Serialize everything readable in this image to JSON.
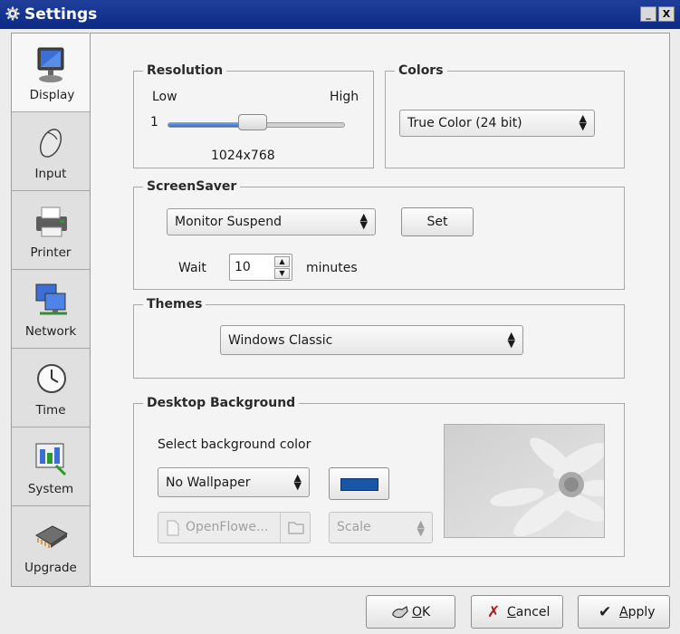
{
  "window": {
    "title": "Settings",
    "minimize": "_",
    "close": "X"
  },
  "sidebar": {
    "items": [
      {
        "label": "Display",
        "icon": "monitor-icon"
      },
      {
        "label": "Input",
        "icon": "mouse-icon"
      },
      {
        "label": "Printer",
        "icon": "printer-icon"
      },
      {
        "label": "Network",
        "icon": "network-icon"
      },
      {
        "label": "Time",
        "icon": "clock-icon"
      },
      {
        "label": "System",
        "icon": "system-icon"
      },
      {
        "label": "Upgrade",
        "icon": "chip-icon"
      }
    ],
    "active": "Display"
  },
  "resolution": {
    "title": "Resolution",
    "low_label": "Low",
    "high_label": "High",
    "min_value": "1",
    "value_label": "1024x768",
    "slider_level": 0.5
  },
  "colors": {
    "title": "Colors",
    "selected": "True Color (24 bit)"
  },
  "screensaver": {
    "title": "ScreenSaver",
    "selected": "Monitor Suspend",
    "set_label": "Set",
    "wait_label": "Wait",
    "wait_value": "10",
    "minutes_label": "minutes"
  },
  "themes": {
    "title": "Themes",
    "selected": "Windows Classic"
  },
  "desktop_background": {
    "title": "Desktop Background",
    "select_label": "Select background color",
    "wallpaper_selected": "No Wallpaper",
    "color": "#1a56a8",
    "file_button_label": "OpenFlowe...",
    "scale_selected": "Scale"
  },
  "footer": {
    "ok_label": "OK",
    "cancel_label": "Cancel",
    "apply_label": "Apply"
  },
  "colors_palette": {
    "titlebar": "#0b2a86",
    "accent": "#2f6fc8"
  }
}
